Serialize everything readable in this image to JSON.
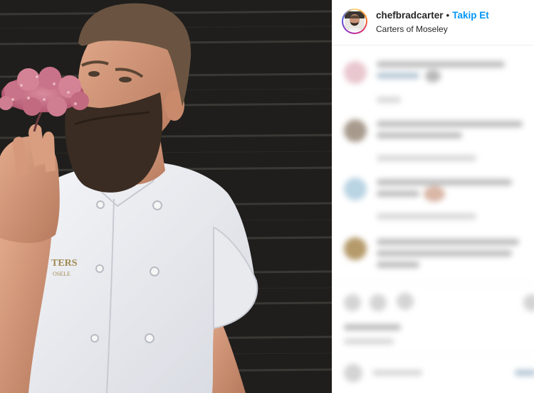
{
  "post_header": {
    "username": "chefbradcarter",
    "separator": "•",
    "follow_label": "Takip Et",
    "location": "Carters of Moseley",
    "more_icon": "more-icon",
    "more_glyph": "⋮"
  },
  "photo": {
    "apron_text_line1": "TERS",
    "apron_text_line2": "OSELE"
  },
  "colors": {
    "follow_blue": "#0095f6",
    "text_primary": "#262626",
    "divider": "#efefef"
  }
}
